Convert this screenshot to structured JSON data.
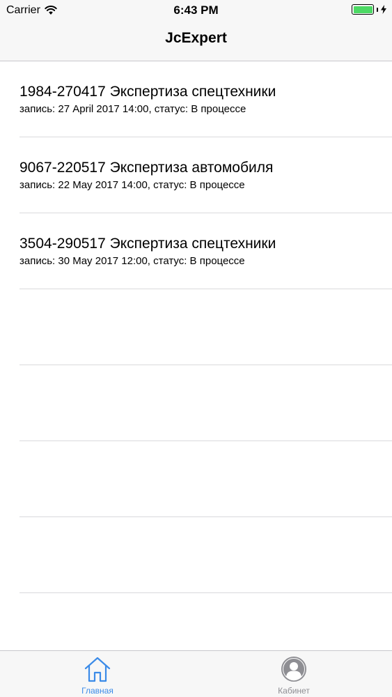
{
  "status_bar": {
    "carrier": "Carrier",
    "time": "6:43 PM",
    "battery_color": "#4cd964"
  },
  "nav": {
    "title": "JcExpert"
  },
  "list": {
    "items": [
      {
        "title": "1984-270417 Экспертиза спецтехники",
        "subtitle": "запись: 27 April 2017 14:00, статус: В процессе"
      },
      {
        "title": "9067-220517 Экспертиза автомобиля",
        "subtitle": "запись: 22 May 2017 14:00, статус: В процессе"
      },
      {
        "title": "3504-290517 Экспертиза спецтехники",
        "subtitle": "запись: 30 May 2017 12:00, статус: В процессе"
      }
    ]
  },
  "tab_bar": {
    "tabs": [
      {
        "label": "Главная",
        "icon": "home-icon",
        "selected": true,
        "color": "#3b8be8"
      },
      {
        "label": "Кабинет",
        "icon": "user-profile-icon",
        "selected": false,
        "color": "#8e8e93"
      }
    ]
  }
}
